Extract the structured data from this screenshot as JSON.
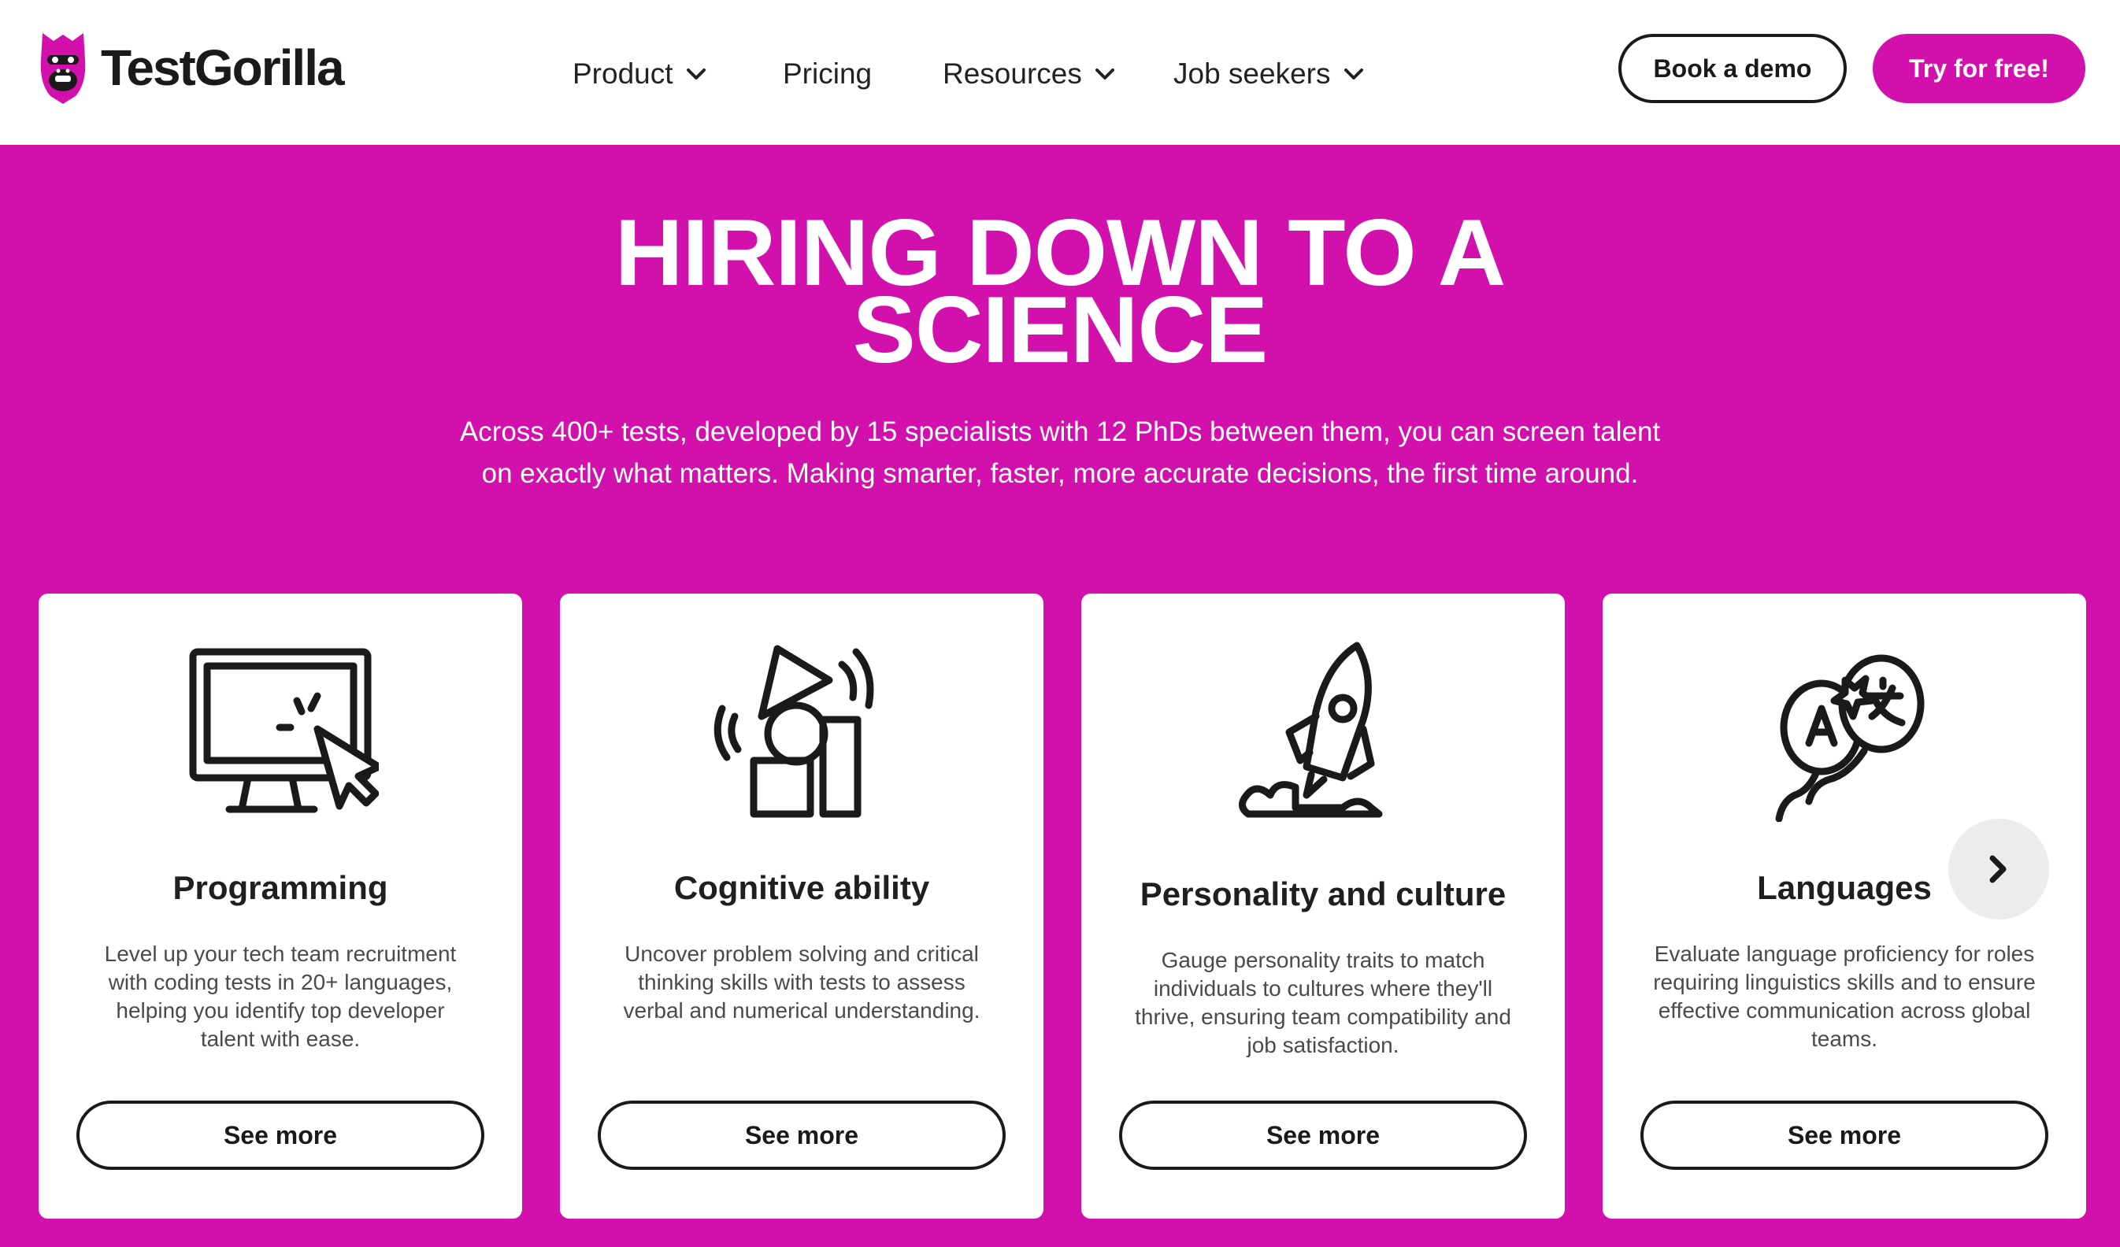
{
  "brand": {
    "name": "TestGorilla",
    "accent_color": "#d211ac",
    "logo_icon": "gorilla-icon"
  },
  "nav": {
    "items": [
      {
        "label": "Product",
        "has_dropdown": true
      },
      {
        "label": "Pricing",
        "has_dropdown": false
      },
      {
        "label": "Resources",
        "has_dropdown": true
      },
      {
        "label": "Job seekers",
        "has_dropdown": true
      }
    ],
    "book_demo": "Book a demo",
    "try_free": "Try for free!"
  },
  "hero": {
    "title_line1": "HIRING DOWN TO A",
    "title_line2": "SCIENCE",
    "subtitle_line1": "Across 400+ tests, developed by 15 specialists with 12 PhDs between them, you can screen talent",
    "subtitle_line2": "on exactly what matters. Making smarter, faster, more accurate decisions, the first time around."
  },
  "cards": [
    {
      "icon": "monitor-cursor-icon",
      "title": "Programming",
      "desc_lines": [
        "Level up your tech team recruitment",
        "with coding tests in 20+ languages,",
        "helping you identify top developer",
        "talent with ease."
      ],
      "button": "See more"
    },
    {
      "icon": "shapes-icon",
      "title": "Cognitive ability",
      "desc_lines": [
        "Uncover problem solving and critical",
        "thinking skills with tests to assess",
        "verbal and numerical understanding."
      ],
      "button": "See more"
    },
    {
      "icon": "rocket-icon",
      "title": "Personality and culture",
      "desc_lines": [
        "Gauge personality traits to match",
        "individuals to cultures where they'll",
        "thrive, ensuring team compatibility and",
        "job satisfaction."
      ],
      "button": "See more"
    },
    {
      "icon": "language-balloons-icon",
      "title": "Languages",
      "desc_lines": [
        "Evaluate language proficiency for roles",
        "requiring linguistics skills and to ensure",
        "effective communication across global",
        "teams."
      ],
      "button": "See more"
    }
  ],
  "carousel": {
    "next_icon": "chevron-right-icon"
  }
}
